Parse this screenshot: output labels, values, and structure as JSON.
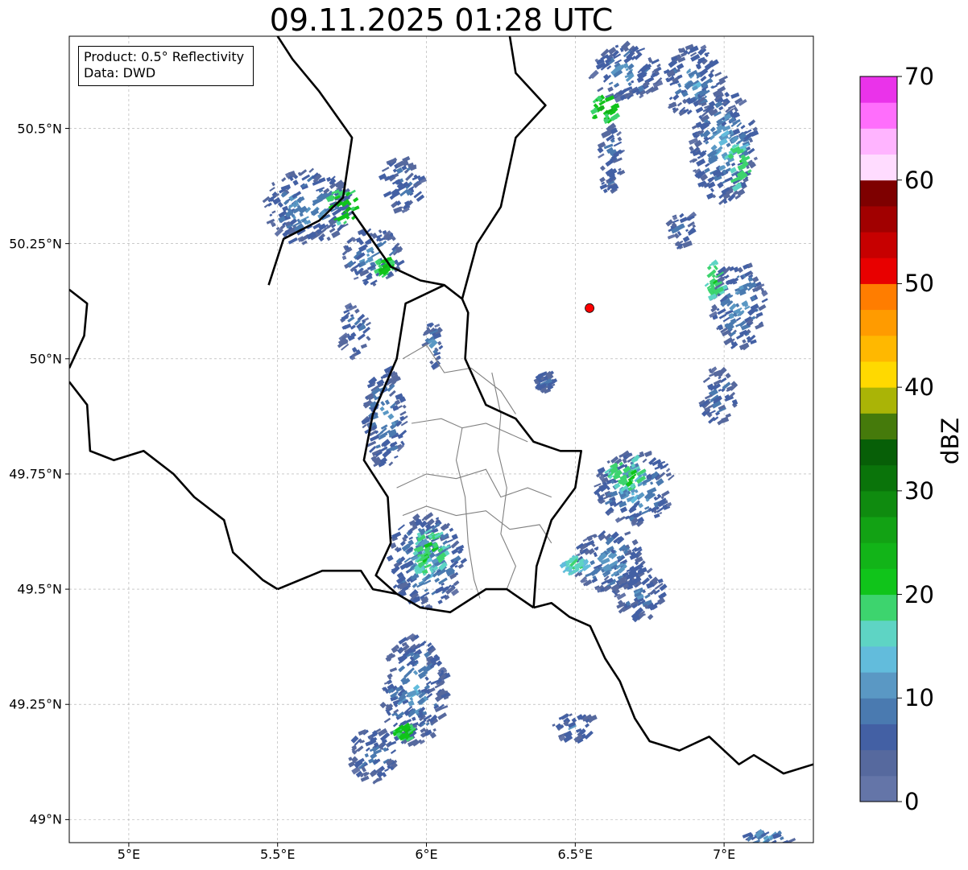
{
  "title": "09.11.2025 01:28 UTC",
  "info_box": {
    "product": "Product: 0.5° Reflectivity",
    "source": "Data: DWD"
  },
  "lat_ticks": [
    {
      "value": 50.5,
      "label": "50.5°N"
    },
    {
      "value": 50.25,
      "label": "50.25°N"
    },
    {
      "value": 50.0,
      "label": "50°N"
    },
    {
      "value": 49.75,
      "label": "49.75°N"
    },
    {
      "value": 49.5,
      "label": "49.5°N"
    },
    {
      "value": 49.25,
      "label": "49.25°N"
    },
    {
      "value": 49.0,
      "label": "49°N"
    }
  ],
  "lon_ticks": [
    {
      "value": 5.0,
      "label": "5°E"
    },
    {
      "value": 5.5,
      "label": "5.5°E"
    },
    {
      "value": 6.0,
      "label": "6°E"
    },
    {
      "value": 6.5,
      "label": "6.5°E"
    },
    {
      "value": 7.0,
      "label": "7°E"
    }
  ],
  "extent": {
    "lon_min": 4.8,
    "lon_max": 7.3,
    "lat_min": 48.95,
    "lat_max": 50.7
  },
  "radar_site": {
    "lon": 6.548,
    "lat": 50.11,
    "color": "#ff0000"
  },
  "colorbar": {
    "label": "dBZ",
    "min": 0,
    "max": 70,
    "ticks": [
      {
        "value": 0,
        "label": "0"
      },
      {
        "value": 10,
        "label": "10"
      },
      {
        "value": 20,
        "label": "20"
      },
      {
        "value": 30,
        "label": "30"
      },
      {
        "value": 40,
        "label": "40"
      },
      {
        "value": 50,
        "label": "50"
      },
      {
        "value": 60,
        "label": "60"
      },
      {
        "value": 70,
        "label": "70"
      }
    ],
    "colors": [
      "#6475a8",
      "#56699e",
      "#4360a4",
      "#4a7ab0",
      "#5a98c4",
      "#62bcdc",
      "#5ed4c4",
      "#3dd46e",
      "#10c41a",
      "#12b418",
      "#12a214",
      "#0f8b0f",
      "#0a740a",
      "#075f07",
      "#457a0b",
      "#aab406",
      "#ffd900",
      "#ffb800",
      "#ff9b00",
      "#ff7d00",
      "#e80000",
      "#c70000",
      "#a10000",
      "#7e0000",
      "#ffdcff",
      "#ffb4ff",
      "#ff6efc",
      "#ea33ea"
    ]
  },
  "echoes": [
    {
      "lon": 5.6,
      "lat": 50.33,
      "rx": 0.15,
      "ry": 0.08,
      "level": 4
    },
    {
      "lon": 5.82,
      "lat": 50.22,
      "rx": 0.1,
      "ry": 0.06,
      "level": 4
    },
    {
      "lon": 5.92,
      "lat": 50.38,
      "rx": 0.07,
      "ry": 0.06,
      "level": 3
    },
    {
      "lon": 5.72,
      "lat": 50.33,
      "rx": 0.05,
      "ry": 0.04,
      "level": 9
    },
    {
      "lon": 5.86,
      "lat": 50.2,
      "rx": 0.03,
      "ry": 0.02,
      "level": 9
    },
    {
      "lon": 5.76,
      "lat": 50.06,
      "rx": 0.05,
      "ry": 0.06,
      "level": 3
    },
    {
      "lon": 6.02,
      "lat": 50.03,
      "rx": 0.03,
      "ry": 0.05,
      "level": 3
    },
    {
      "lon": 5.86,
      "lat": 49.87,
      "rx": 0.07,
      "ry": 0.11,
      "level": 4
    },
    {
      "lon": 6.0,
      "lat": 49.56,
      "rx": 0.13,
      "ry": 0.1,
      "level": 5
    },
    {
      "lon": 6.01,
      "lat": 49.58,
      "rx": 0.06,
      "ry": 0.05,
      "level": 8
    },
    {
      "lon": 5.96,
      "lat": 49.28,
      "rx": 0.11,
      "ry": 0.12,
      "level": 4
    },
    {
      "lon": 5.93,
      "lat": 49.19,
      "rx": 0.03,
      "ry": 0.02,
      "level": 9
    },
    {
      "lon": 5.82,
      "lat": 49.14,
      "rx": 0.08,
      "ry": 0.06,
      "level": 3
    },
    {
      "lon": 6.67,
      "lat": 50.62,
      "rx": 0.12,
      "ry": 0.06,
      "level": 4
    },
    {
      "lon": 6.6,
      "lat": 50.54,
      "rx": 0.05,
      "ry": 0.03,
      "level": 9
    },
    {
      "lon": 6.62,
      "lat": 50.43,
      "rx": 0.04,
      "ry": 0.08,
      "level": 3
    },
    {
      "lon": 6.9,
      "lat": 50.6,
      "rx": 0.1,
      "ry": 0.08,
      "level": 4
    },
    {
      "lon": 7.0,
      "lat": 50.46,
      "rx": 0.11,
      "ry": 0.12,
      "level": 5
    },
    {
      "lon": 7.05,
      "lat": 50.42,
      "rx": 0.04,
      "ry": 0.05,
      "level": 8
    },
    {
      "lon": 6.86,
      "lat": 50.28,
      "rx": 0.05,
      "ry": 0.04,
      "level": 3
    },
    {
      "lon": 7.05,
      "lat": 50.12,
      "rx": 0.09,
      "ry": 0.1,
      "level": 4
    },
    {
      "lon": 6.97,
      "lat": 50.17,
      "rx": 0.03,
      "ry": 0.04,
      "level": 8
    },
    {
      "lon": 6.98,
      "lat": 49.92,
      "rx": 0.06,
      "ry": 0.06,
      "level": 3
    },
    {
      "lon": 6.7,
      "lat": 49.72,
      "rx": 0.13,
      "ry": 0.08,
      "level": 5
    },
    {
      "lon": 6.67,
      "lat": 49.75,
      "rx": 0.06,
      "ry": 0.04,
      "level": 8
    },
    {
      "lon": 6.62,
      "lat": 49.56,
      "rx": 0.12,
      "ry": 0.07,
      "level": 4
    },
    {
      "lon": 6.5,
      "lat": 49.55,
      "rx": 0.04,
      "ry": 0.02,
      "level": 7
    },
    {
      "lon": 6.72,
      "lat": 49.49,
      "rx": 0.08,
      "ry": 0.06,
      "level": 3
    },
    {
      "lon": 6.5,
      "lat": 49.2,
      "rx": 0.08,
      "ry": 0.03,
      "level": 3
    },
    {
      "lon": 6.4,
      "lat": 49.95,
      "rx": 0.03,
      "ry": 0.02,
      "level": 3
    },
    {
      "lon": 7.15,
      "lat": 48.96,
      "rx": 0.08,
      "ry": 0.02,
      "level": 5
    }
  ],
  "borders_national": [
    [
      [
        5.48,
        50.72
      ],
      [
        5.55,
        50.65
      ],
      [
        5.64,
        50.58
      ],
      [
        5.75,
        50.48
      ],
      [
        5.72,
        50.35
      ],
      [
        5.64,
        50.3
      ],
      [
        5.52,
        50.26
      ],
      [
        5.47,
        50.16
      ]
    ],
    [
      [
        4.8,
        50.15
      ],
      [
        4.86,
        50.12
      ],
      [
        4.85,
        50.05
      ],
      [
        4.8,
        49.98
      ]
    ],
    [
      [
        4.8,
        49.95
      ],
      [
        4.86,
        49.9
      ],
      [
        4.87,
        49.8
      ],
      [
        4.95,
        49.78
      ],
      [
        5.05,
        49.8
      ],
      [
        5.15,
        49.75
      ],
      [
        5.22,
        49.7
      ],
      [
        5.32,
        49.65
      ],
      [
        5.35,
        49.58
      ],
      [
        5.45,
        49.52
      ],
      [
        5.5,
        49.5
      ]
    ],
    [
      [
        5.5,
        49.5
      ],
      [
        5.65,
        49.54
      ],
      [
        5.78,
        49.54
      ],
      [
        5.82,
        49.5
      ],
      [
        5.9,
        49.49
      ],
      [
        5.98,
        49.46
      ],
      [
        6.08,
        49.45
      ],
      [
        6.2,
        49.5
      ],
      [
        6.27,
        49.5
      ],
      [
        6.36,
        49.46
      ]
    ],
    [
      [
        6.36,
        49.46
      ],
      [
        6.42,
        49.47
      ],
      [
        6.48,
        49.44
      ],
      [
        6.55,
        49.42
      ],
      [
        6.6,
        49.35
      ],
      [
        6.65,
        49.3
      ],
      [
        6.7,
        49.22
      ],
      [
        6.75,
        49.17
      ],
      [
        6.85,
        49.15
      ],
      [
        6.95,
        49.18
      ],
      [
        7.05,
        49.12
      ],
      [
        7.1,
        49.14
      ],
      [
        7.2,
        49.1
      ],
      [
        7.3,
        49.12
      ]
    ],
    [
      [
        5.75,
        50.32
      ],
      [
        5.88,
        50.2
      ],
      [
        5.98,
        50.17
      ],
      [
        6.06,
        50.16
      ],
      [
        6.12,
        50.13
      ],
      [
        6.14,
        50.1
      ],
      [
        6.13,
        50.0
      ],
      [
        6.2,
        49.9
      ],
      [
        6.3,
        49.87
      ],
      [
        6.36,
        49.82
      ],
      [
        6.45,
        49.8
      ],
      [
        6.52,
        49.8
      ],
      [
        6.5,
        49.72
      ],
      [
        6.42,
        49.65
      ],
      [
        6.37,
        49.55
      ],
      [
        6.36,
        49.46
      ]
    ],
    [
      [
        6.12,
        50.13
      ],
      [
        6.17,
        50.25
      ],
      [
        6.25,
        50.33
      ],
      [
        6.3,
        50.48
      ],
      [
        6.4,
        50.55
      ],
      [
        6.3,
        50.62
      ],
      [
        6.28,
        50.7
      ]
    ],
    [
      [
        6.06,
        50.16
      ],
      [
        5.93,
        50.12
      ],
      [
        5.9,
        50.0
      ],
      [
        5.82,
        49.88
      ],
      [
        5.79,
        49.78
      ],
      [
        5.87,
        49.7
      ],
      [
        5.88,
        49.6
      ],
      [
        5.83,
        49.53
      ],
      [
        5.9,
        49.49
      ]
    ]
  ],
  "borders_regional": [
    [
      [
        5.92,
        50.0
      ],
      [
        6.0,
        50.03
      ],
      [
        6.06,
        49.97
      ],
      [
        6.15,
        49.98
      ],
      [
        6.25,
        49.93
      ],
      [
        6.3,
        49.88
      ]
    ],
    [
      [
        5.95,
        49.86
      ],
      [
        6.05,
        49.87
      ],
      [
        6.12,
        49.85
      ],
      [
        6.2,
        49.86
      ],
      [
        6.27,
        49.84
      ],
      [
        6.34,
        49.82
      ]
    ],
    [
      [
        5.9,
        49.72
      ],
      [
        6.0,
        49.75
      ],
      [
        6.1,
        49.74
      ],
      [
        6.2,
        49.76
      ],
      [
        6.25,
        49.7
      ],
      [
        6.34,
        49.72
      ],
      [
        6.42,
        49.7
      ]
    ],
    [
      [
        5.92,
        49.66
      ],
      [
        6.0,
        49.68
      ],
      [
        6.1,
        49.66
      ],
      [
        6.2,
        49.67
      ],
      [
        6.28,
        49.63
      ],
      [
        6.38,
        49.64
      ],
      [
        6.42,
        49.6
      ]
    ],
    [
      [
        6.12,
        49.85
      ],
      [
        6.1,
        49.78
      ],
      [
        6.13,
        49.7
      ],
      [
        6.14,
        49.6
      ],
      [
        6.16,
        49.52
      ],
      [
        6.18,
        49.48
      ]
    ],
    [
      [
        6.22,
        49.97
      ],
      [
        6.25,
        49.88
      ],
      [
        6.24,
        49.8
      ],
      [
        6.27,
        49.72
      ],
      [
        6.25,
        49.62
      ],
      [
        6.3,
        49.55
      ],
      [
        6.27,
        49.5
      ]
    ]
  ]
}
